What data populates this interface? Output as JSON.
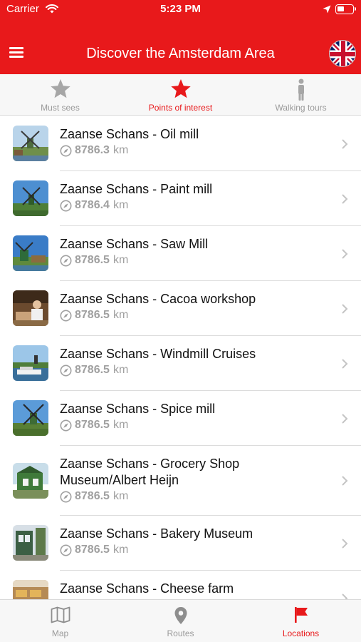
{
  "status_bar": {
    "carrier": "Carrier",
    "time": "5:23 PM"
  },
  "header": {
    "title": "Discover the Amsterdam Area",
    "menu_icon": "hamburger-menu-icon",
    "language_icon": "uk-flag-icon"
  },
  "segments": [
    {
      "label": "Must sees",
      "icon": "star-icon",
      "active": false
    },
    {
      "label": "Points of interest",
      "icon": "star-icon",
      "active": true
    },
    {
      "label": "Walking tours",
      "icon": "person-icon",
      "active": false
    }
  ],
  "list": {
    "items": [
      {
        "name": "Zaanse Schans - Oil mill",
        "distance": "8786.3",
        "unit": "km"
      },
      {
        "name": "Zaanse Schans - Paint mill",
        "distance": "8786.4",
        "unit": "km"
      },
      {
        "name": "Zaanse Schans - Saw Mill",
        "distance": "8786.5",
        "unit": "km"
      },
      {
        "name": "Zaanse Schans - Cacoa workshop",
        "distance": "8786.5",
        "unit": "km"
      },
      {
        "name": "Zaanse Schans - Windmill Cruises",
        "distance": "8786.5",
        "unit": "km"
      },
      {
        "name": "Zaanse Schans - Spice mill",
        "distance": "8786.5",
        "unit": "km"
      },
      {
        "name": "Zaanse Schans - Grocery Shop Museum/Albert Heijn",
        "distance": "8786.5",
        "unit": "km"
      },
      {
        "name": "Zaanse Schans - Bakery Museum",
        "distance": "8786.5",
        "unit": "km"
      },
      {
        "name": "Zaanse Schans - Cheese farm",
        "distance": "",
        "unit": ""
      }
    ]
  },
  "tabbar": [
    {
      "label": "Map",
      "icon": "map-icon",
      "active": false
    },
    {
      "label": "Routes",
      "icon": "location-pin-icon",
      "active": false
    },
    {
      "label": "Locations",
      "icon": "flag-icon",
      "active": true
    }
  ],
  "colors": {
    "accent": "#e8191b",
    "inactive": "#9a9a9a",
    "text": "#111111",
    "separator": "#dcdcdc"
  }
}
